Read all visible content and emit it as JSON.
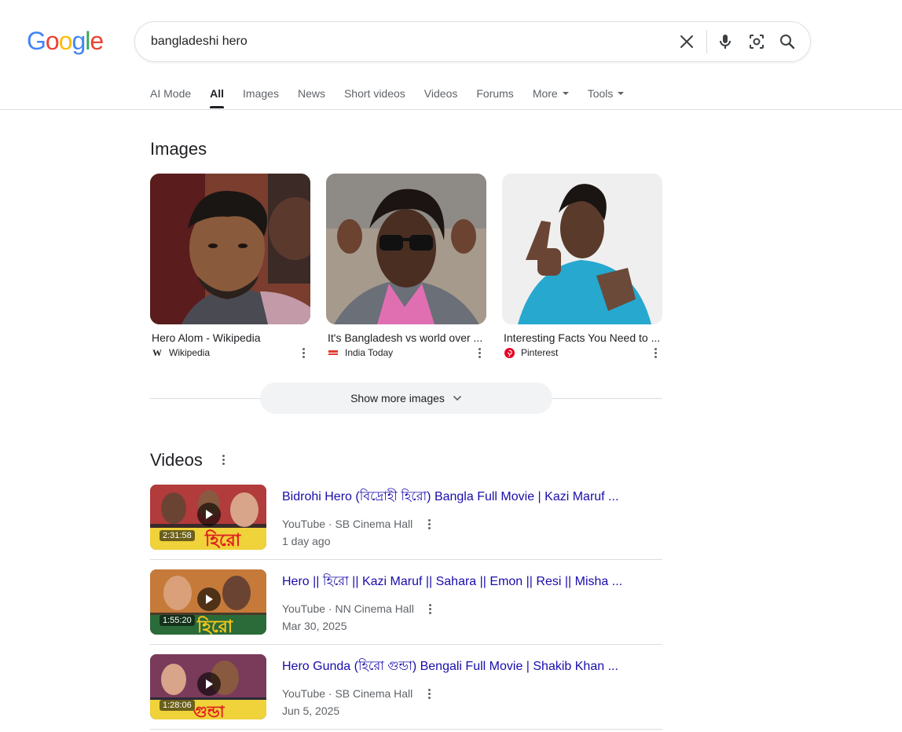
{
  "logo": {
    "text": "Google"
  },
  "search": {
    "query": "bangladeshi hero"
  },
  "tabs": [
    {
      "label": "AI Mode",
      "active": false
    },
    {
      "label": "All",
      "active": true
    },
    {
      "label": "Images",
      "active": false
    },
    {
      "label": "News",
      "active": false
    },
    {
      "label": "Short videos",
      "active": false
    },
    {
      "label": "Videos",
      "active": false
    },
    {
      "label": "Forums",
      "active": false
    },
    {
      "label": "More",
      "active": false,
      "dropdown": true
    },
    {
      "label": "Tools",
      "active": false,
      "dropdown": true
    }
  ],
  "images_section": {
    "title": "Images",
    "items": [
      {
        "title": "Hero Alom - Wikipedia",
        "source": "Wikipedia",
        "favicon": "W"
      },
      {
        "title": "It's Bangladesh vs world over ...",
        "source": "India Today",
        "favicon": "india-today-icon"
      },
      {
        "title": "Interesting Facts You Need to ...",
        "source": "Pinterest",
        "favicon": "pinterest-icon"
      }
    ],
    "show_more_label": "Show more images"
  },
  "videos_section": {
    "title": "Videos",
    "items": [
      {
        "title": "Bidrohi Hero (বিদ্রোহী হিরো) Bangla Full Movie | Kazi Maruf ...",
        "source": "YouTube · SB Cinema Hall",
        "date": "1 day ago",
        "duration": "2:31:58"
      },
      {
        "title": "Hero || হিরো || Kazi Maruf || Sahara || Emon || Resi || Misha ...",
        "source": "YouTube · NN Cinema Hall",
        "date": "Mar 30, 2025",
        "duration": "1:55:20"
      },
      {
        "title": "Hero Gunda (হিরো গুন্ডা) Bengali Full Movie | Shakib Khan ...",
        "source": "YouTube · SB Cinema Hall",
        "date": "Jun 5, 2025",
        "duration": "1:28:06"
      }
    ]
  },
  "colors": {
    "link": "#1a0dab",
    "secondary_text": "#5f6368",
    "divider": "#dadce0",
    "logo_blue": "#4285f4",
    "logo_red": "#ea4335",
    "logo_yellow": "#fbbc05",
    "logo_green": "#34a853"
  }
}
